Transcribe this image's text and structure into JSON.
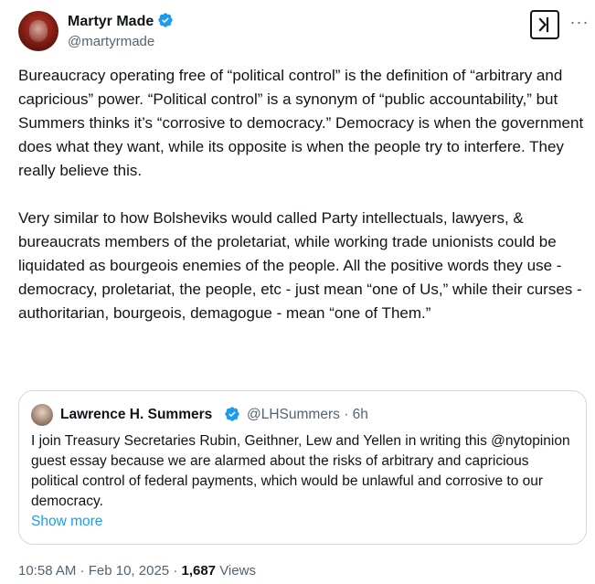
{
  "author": {
    "name": "Martyr Made",
    "handle": "@martyrmade",
    "verified": true
  },
  "actions": {
    "grok_icon": "grok-icon",
    "more_label": "···"
  },
  "tweet": {
    "text": "Bureaucracy operating free of “political control” is the definition of “arbitrary and capricious” power. “Political control” is a synonym of “public accountability,” but Summers thinks it’s “corrosive to democracy.” Democracy is when the government does what they want, while its opposite is when the people try to interfere. They really believe this.\n\nVery similar to how Bolsheviks would called Party intellectuals, lawyers, & bureaucrats members of the proletariat, while working trade unionists could be liquidated as bourgeois enemies of the people. All the positive words they use - democracy, proletariat, the people, etc - just mean “one of Us,” while their curses - authoritarian, bourgeois, demagogue - mean “one of Them.”"
  },
  "quote": {
    "name": "Lawrence H. Summers",
    "handle": "@LHSummers",
    "separator": "·",
    "time": "6h",
    "verified": true,
    "text": "I join Treasury Secretaries Rubin, Geithner, Lew and Yellen in writing this @nytopinion guest essay because we are alarmed about the risks of arbitrary and capricious political control of federal payments, which would be unlawful and corrosive to our democracy.",
    "show_more": "Show more"
  },
  "meta": {
    "time": "10:58 AM",
    "date": "Feb 10, 2025",
    "separator": "·",
    "views": "1,687",
    "views_label": "Views"
  },
  "colors": {
    "verified": "#1d9bf0",
    "link": "#1d9bf0",
    "secondary_text": "#536471",
    "border": "#cfd9de"
  }
}
